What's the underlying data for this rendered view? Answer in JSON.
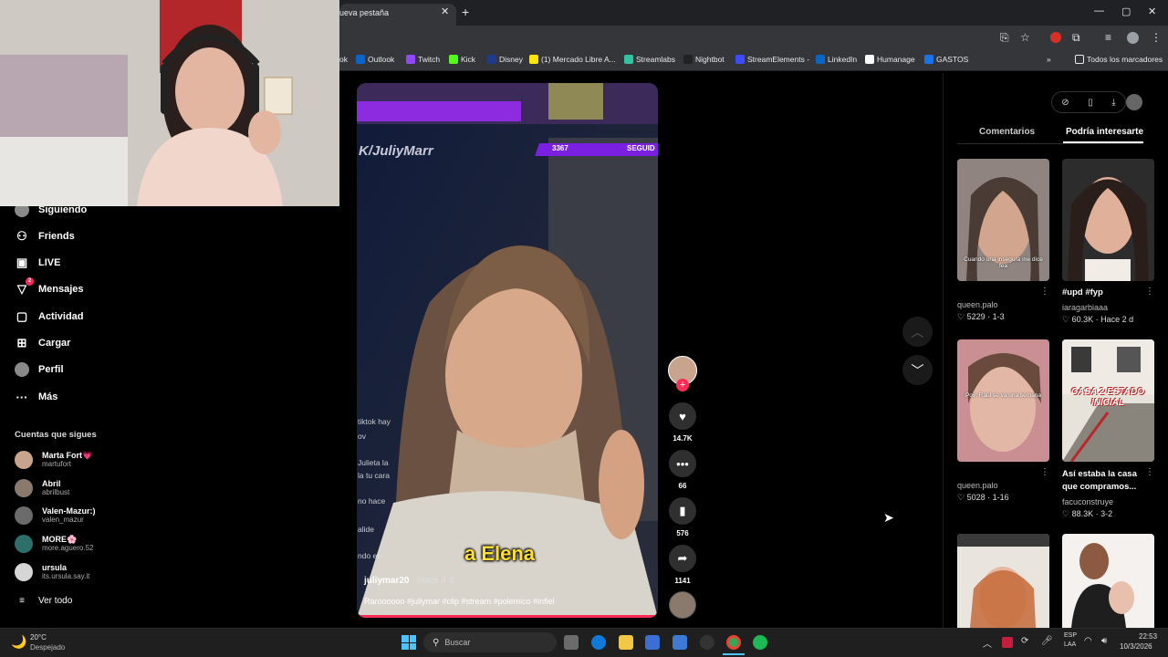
{
  "browser": {
    "tab_title": "ueva pestaña",
    "close": "✕",
    "new_tab": "+",
    "window_controls": [
      "—",
      "▢",
      "✕"
    ],
    "bookmarks": [
      {
        "label": "ok",
        "color": "#888"
      },
      {
        "label": "Outlook",
        "color": "#0a64d0"
      },
      {
        "label": "Twitch",
        "color": "#9146ff"
      },
      {
        "label": "Kick",
        "color": "#53fc18"
      },
      {
        "label": "Disney",
        "color": "#1e3a8a"
      },
      {
        "label": "(1) Mercado Libre A...",
        "color": "#ffe600"
      },
      {
        "label": "Streamlabs",
        "color": "#31c3a2"
      },
      {
        "label": "Nightbot",
        "color": "#222"
      },
      {
        "label": "StreamElements -",
        "color": "#3b4bff"
      },
      {
        "label": "LinkedIn",
        "color": "#0a66c2"
      },
      {
        "label": "Humanage",
        "color": "#fff"
      },
      {
        "label": "GASTOS",
        "color": "#1a73e8"
      }
    ],
    "overflow": "»",
    "all_bookmarks": "Todos los marcadores"
  },
  "sidebar": {
    "items": [
      {
        "label": "Siguiendo",
        "icon": "avatar"
      },
      {
        "label": "Friends",
        "icon": "friends-icon"
      },
      {
        "label": "LIVE",
        "icon": "live-icon"
      },
      {
        "label": "Mensajes",
        "icon": "messages-icon",
        "badge": "2"
      },
      {
        "label": "Actividad",
        "icon": "activity-icon"
      },
      {
        "label": "Cargar",
        "icon": "upload-icon"
      },
      {
        "label": "Perfil",
        "icon": "avatar"
      },
      {
        "label": "Más",
        "icon": "more-icon"
      }
    ],
    "following_header": "Cuentas que sigues",
    "following": [
      {
        "name": "Marta Fort💗",
        "handle": "martufort",
        "color": "#c9a48c"
      },
      {
        "name": "Abril",
        "handle": "abrilbust",
        "color": "#8a7a6e"
      },
      {
        "name": "Valen-Mazur:)",
        "handle": "valen_mazur",
        "color": "#6b6b6b"
      },
      {
        "name": "MORE🌸",
        "handle": "more.aguero.52",
        "color": "#2f6f6a"
      },
      {
        "name": "ursula",
        "handle": "its.ursula.say.it",
        "color": "#d6d6d6"
      }
    ],
    "see_all": "Ver todo"
  },
  "video": {
    "stream_handle": "K/JuliyMarr",
    "follower_count": "3367",
    "follower_label": "SEGUID",
    "overlay_chat": [
      "tiktok hay",
      "ov",
      "Julieta la",
      "la tu cara",
      "no hace",
      "alide",
      "ndo en"
    ],
    "subtitle": "a Elena",
    "author": "juliymar20",
    "time_ago": "· Hace 4 d",
    "description": "Raroooooo #juliymar #clip #stream #polemico #infiel"
  },
  "actions": {
    "likes": "14.7K",
    "comments": "66",
    "saves": "576",
    "shares": "1141"
  },
  "panel": {
    "tabs": [
      "Comentarios",
      "Podría interesarte"
    ],
    "videos": [
      {
        "caption": "",
        "overlay": "Cuando una insegura me dice fea",
        "author": "queen.palo",
        "likes": "5229",
        "meta": "· 1-3"
      },
      {
        "caption": "#upd #fyp",
        "overlay": "",
        "author": "iaragarbiaaa",
        "likes": "60.3K",
        "meta": "· Hace 2 d"
      },
      {
        "caption": "",
        "overlay": "Pov: Raúl se va una semana",
        "author": "queen.palo",
        "likes": "5028",
        "meta": "· 1-16"
      },
      {
        "caption": "Así estaba la casa que compramos...",
        "overlay": "CASA 2 ESTADO INICIAL",
        "author": "facuconstruye",
        "likes": "88.3K",
        "meta": "· 3-2"
      }
    ]
  },
  "taskbar": {
    "weather_temp": "20°C",
    "weather_desc": "Despejado",
    "search_placeholder": "Buscar",
    "lang_top": "ESP",
    "lang_bottom": "LAA",
    "time": "22:53",
    "date": "10/3/2026"
  }
}
